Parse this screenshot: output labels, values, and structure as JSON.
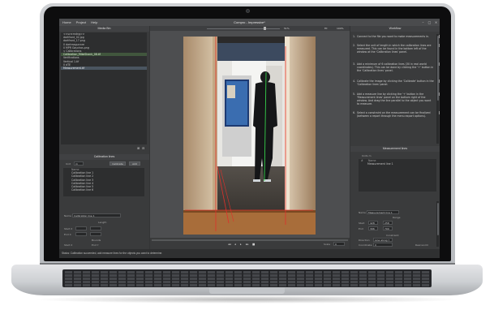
{
  "app": {
    "title": "Compro - Impressive*",
    "menu": [
      "Home",
      "Project",
      "Help"
    ]
  },
  "media": {
    "title": "Media Bin",
    "items": [
      {
        "label": "<<scrcrndng>>",
        "state": "normal"
      },
      {
        "label": "dartfront_02.jpg",
        "state": "normal"
      },
      {
        "label": "dartfront_17.png",
        "state": "normal"
      },
      {
        "label": "0 dartmagunnre",
        "state": "normal"
      },
      {
        "label": "0 MPR Gauchos.png",
        "state": "normal"
      },
      {
        "label": "∨ Calibrations",
        "state": "normal"
      },
      {
        "label": "Calibration_MikeShank_08.tif",
        "state": "green"
      },
      {
        "label": "Verifications",
        "state": "normal"
      },
      {
        "label": "Vertical 1.tif",
        "state": "normal"
      },
      {
        "label": "0 dTE",
        "state": "normal"
      },
      {
        "label": "Measurement.tif",
        "state": "selected"
      }
    ]
  },
  "calibration": {
    "title": "Calibration lines",
    "unit_label": "Unit",
    "unit_value": "m",
    "calibrate_label": "Calibrate",
    "add_label": "Add",
    "header_name": "Name",
    "lines": [
      "Calibration line 1",
      "Calibration line 2",
      "Calibration line 3",
      "Calibration line 4",
      "Calibration line 5",
      "Calibration line 6"
    ],
    "detail_name_label": "Name",
    "detail_name_value": "Calibration line 1",
    "length_label": "Length",
    "start_label": "Start X",
    "end_label": "End X",
    "start_value": "",
    "end_value": "",
    "bounds_label": "Bounds",
    "start2_label": "Start X",
    "end2_label": "End Y"
  },
  "viewer": {
    "zoom": "51%",
    "fit_label": "Fit",
    "zoom_100": "100%",
    "controls": [
      "◂◂",
      "◂",
      "▸",
      "▸▸",
      "■"
    ],
    "scale_label": "Scale",
    "scale_value": "0"
  },
  "workflow": {
    "title": "Workflow",
    "steps": [
      {
        "num": "1.",
        "text": "Connect to the file you want to make measurements in.",
        "checked": true
      },
      {
        "num": "2.",
        "text": "Select the unit of length in which the calibration lines are measured. This can be found in the bottom left of the window at the 'Calibration lines' panel.",
        "checked": true
      },
      {
        "num": "3.",
        "text": "Add a minimum of 6 calibration lines (30 in real world coordinates). This can be done by clicking the '+' button in the 'Calibration lines' panel.",
        "checked": true
      },
      {
        "num": "4.",
        "text": "Calibrate the image by clicking the 'Calibrate' button in the 'Calibration lines' panel.",
        "checked": true
      },
      {
        "num": "5.",
        "text": "Add a measure line by clicking the '+' button in the 'Measurement lines' panel on the bottom right of the window. And drag the line parallel to the object you want to measure.",
        "checked": true
      },
      {
        "num": "6.",
        "text": "Select a constraint on the measurement can be finalized (between a report through the menu export options).",
        "checked": true
      }
    ]
  },
  "measurement": {
    "title": "Measurement lines",
    "unit_label": "Units  m",
    "header_num": "#",
    "header_name": "Name",
    "lines": [
      "Measurement line 1"
    ],
    "detail_name_label": "Name",
    "detail_name_value": "Measurement line 1",
    "range_label": "Range",
    "start_label": "Start",
    "end_label": "End",
    "start_x": "428",
    "start_y": "258",
    "end_x": "396",
    "end_y": "700",
    "constraint_label": "Constraint",
    "direction_label": "Direction",
    "direction_value": "Line along Y",
    "coordinate_label": "Coordinate",
    "coordinate_value": "X",
    "length_label": "Real world"
  },
  "status": {
    "text": "Status: Calibration succeeded, add measure lines for the objects you want to determine."
  }
}
